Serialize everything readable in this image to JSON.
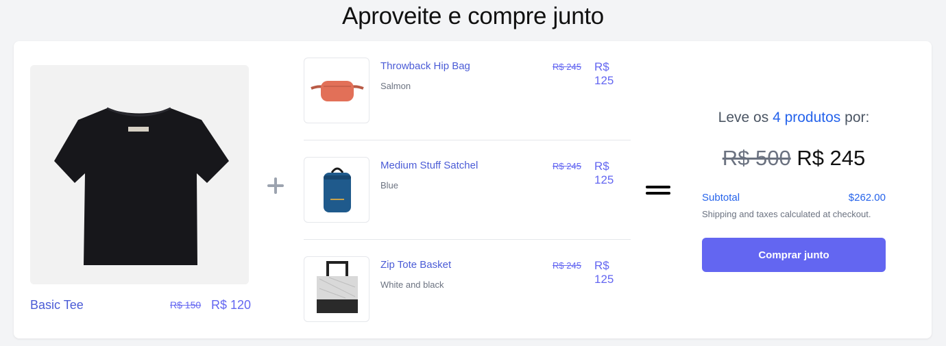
{
  "page": {
    "title": "Aproveite e compre junto"
  },
  "main_product": {
    "name": "Basic Tee",
    "old_price": "R$ 150",
    "new_price": "R$ 120",
    "image_icon": "black-tshirt-image"
  },
  "bundle_items": [
    {
      "name": "Throwback Hip Bag",
      "variant": "Salmon",
      "old_price": "R$ 245",
      "new_price": "R$ 125",
      "image_icon": "salmon-hip-bag-image",
      "color": "#e27058"
    },
    {
      "name": "Medium Stuff Satchel",
      "variant": "Blue",
      "old_price": "R$ 245",
      "new_price": "R$ 125",
      "image_icon": "blue-satchel-image",
      "color": "#1f5a8c"
    },
    {
      "name": "Zip Tote Basket",
      "variant": "White and black",
      "old_price": "R$ 245",
      "new_price": "R$ 125",
      "image_icon": "tote-basket-image",
      "color": "#2a2a2a"
    }
  ],
  "summary": {
    "offer_prefix": "Leve os",
    "offer_highlight": "4 produtos",
    "offer_suffix": "por:",
    "old_total": "R$ 500",
    "new_total": "R$ 245",
    "subtotal_label": "Subtotal",
    "subtotal_value": "$262.00",
    "shipping_note": "Shipping and taxes calculated at checkout.",
    "buy_button_label": "Comprar junto"
  },
  "colors": {
    "accent": "#6366f1",
    "link": "#4a5bd6",
    "background": "#f3f4f6"
  }
}
